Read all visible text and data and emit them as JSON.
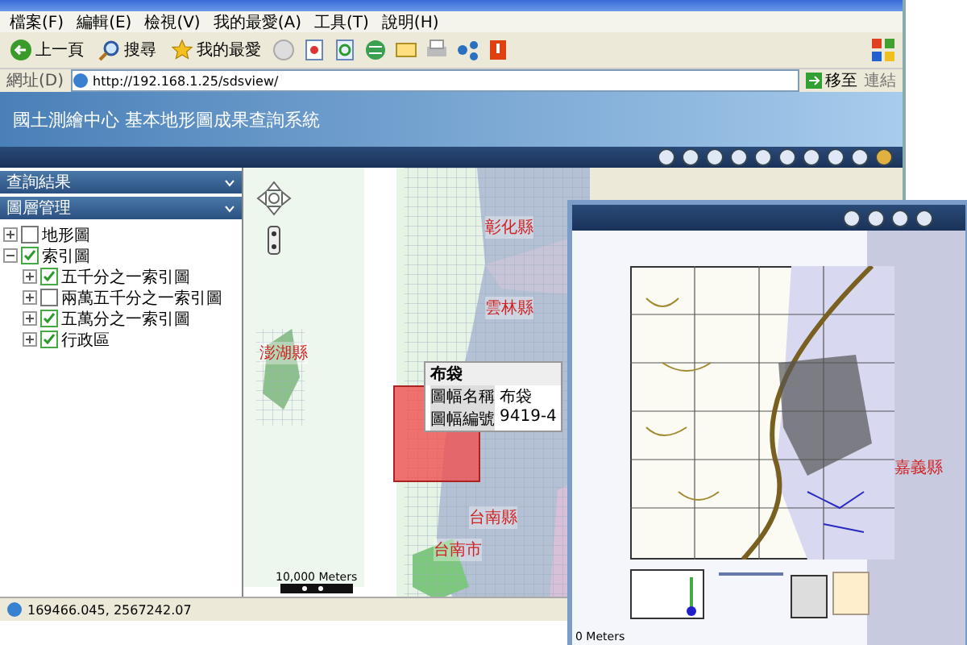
{
  "browser": {
    "menu": [
      "檔案(F)",
      "編輯(E)",
      "檢視(V)",
      "我的最愛(A)",
      "工具(T)",
      "說明(H)"
    ],
    "toolbar": [
      {
        "label": "上一頁",
        "kind": "back"
      },
      {
        "label": "搜尋",
        "kind": "search"
      },
      {
        "label": "我的最愛",
        "kind": "favorites"
      }
    ],
    "address": {
      "label": "網址(D)",
      "value": "http://192.168.1.25/sdsview/",
      "go": "移至",
      "links": "連結"
    }
  },
  "app": {
    "title": "國土測繪中心 基本地形圖成果查詢系統",
    "panels": [
      "查詢結果",
      "圖層管理"
    ],
    "layers": [
      {
        "label": "地形圖",
        "checked": false,
        "expanded": false
      },
      {
        "label": "索引圖",
        "checked": true,
        "expanded": true,
        "children": [
          {
            "label": "五千分之一索引圖",
            "checked": true,
            "expanded": false
          },
          {
            "label": "兩萬五千分之一索引圖",
            "checked": false,
            "expanded": false
          },
          {
            "label": "五萬分之一索引圖",
            "checked": true,
            "expanded": false
          },
          {
            "label": "行政區",
            "checked": true,
            "expanded": false
          }
        ]
      }
    ]
  },
  "map": {
    "labels": [
      "彰化縣",
      "雲林縣",
      "澎湖縣",
      "台南縣",
      "台南市"
    ],
    "popup": {
      "title": "布袋",
      "rows": [
        {
          "label": "圖幅名稱",
          "value": "布袋"
        },
        {
          "label": "圖幅編號",
          "value": "9419-4"
        }
      ]
    },
    "scale": "10,000 Meters"
  },
  "status_bar": "169466.045, 2567242.07",
  "inset": {
    "label": "嘉義縣",
    "scale": "0 Meters"
  }
}
